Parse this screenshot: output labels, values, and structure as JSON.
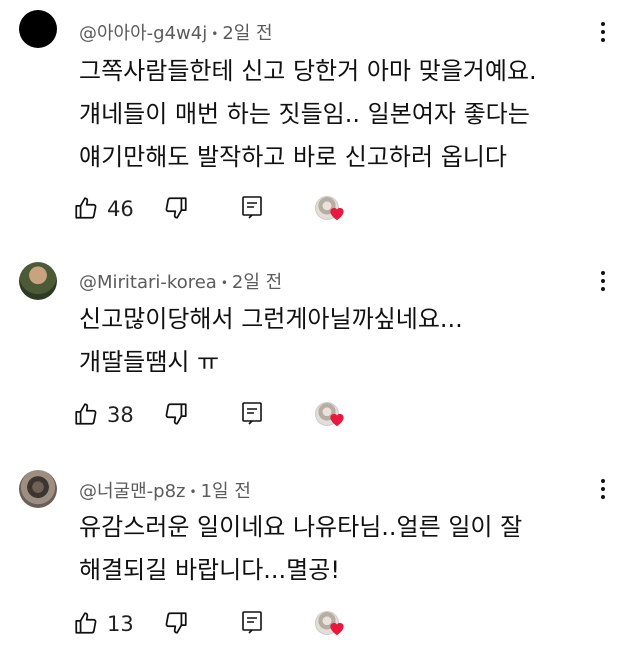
{
  "comments": [
    {
      "author": "@아아아-g4w4j",
      "time": "2일 전",
      "lines": [
        "그쪽사람들한테 신고 당한거 아마 맞을거예요.",
        "걔네들이 매번 하는 짓들임.. 일본여자 좋다는",
        "얘기만해도 발작하고 바로 신고하러 옵니다"
      ],
      "likes": "46",
      "avatar": "black-circle"
    },
    {
      "author": "@Miritari-korea",
      "time": "2일 전",
      "lines": [
        "신고많이당해서 그런게아닐까싶네요...",
        "개딸들땜시 ㅠ"
      ],
      "likes": "38",
      "avatar": "soldier-photo"
    },
    {
      "author": "@너굴맨-p8z",
      "time": "1일 전",
      "lines": [
        "유감스러운 일이네요 나유타님..얼른 일이 잘",
        "해결되길 바랍니다...멸공!"
      ],
      "likes": "13",
      "avatar": "raccoon-photo"
    }
  ],
  "separator": "•",
  "icons": {
    "like": "thumbs-up-icon",
    "dislike": "thumbs-down-icon",
    "reply": "reply-icon",
    "heart": "creator-heart-icon",
    "menu": "more-vert-icon"
  },
  "colors": {
    "heart": "#e8193c",
    "meta": "#5b5b5b"
  }
}
